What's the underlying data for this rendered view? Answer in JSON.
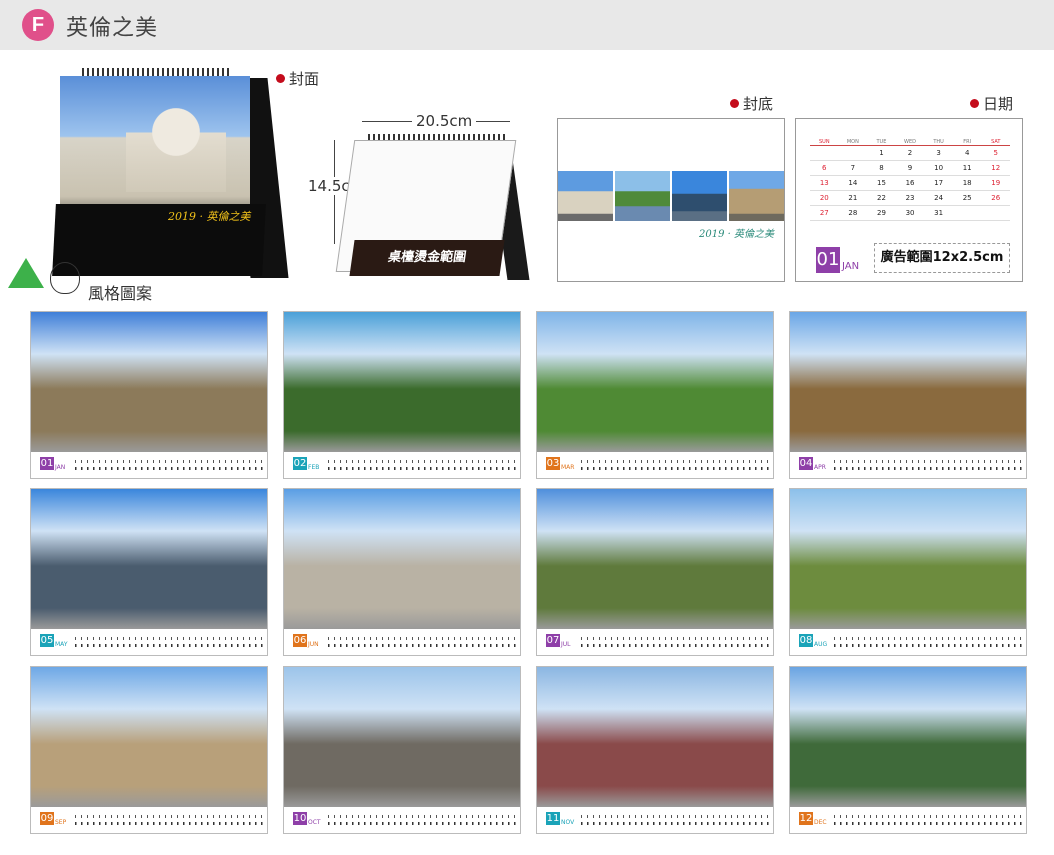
{
  "header": {
    "badge": "F",
    "title": "英倫之美"
  },
  "labels": {
    "cover": "封面",
    "back": "封底",
    "dates": "日期",
    "style": "風格圖案"
  },
  "cover": {
    "brand": "2019 · 英倫之美"
  },
  "blank": {
    "width": "20.5cm",
    "height": "14.5cm",
    "base_text": "桌檯燙金範圍"
  },
  "backcover": {
    "brand": "2019 · 英倫之美"
  },
  "datecard": {
    "weekdays": [
      "SUN",
      "MON",
      "TUE",
      "WED",
      "THU",
      "FRI",
      "SAT"
    ],
    "rows": [
      [
        "",
        "",
        "1",
        "2",
        "3",
        "4",
        "5"
      ],
      [
        "6",
        "7",
        "8",
        "9",
        "10",
        "11",
        "12"
      ],
      [
        "13",
        "14",
        "15",
        "16",
        "17",
        "18",
        "19"
      ],
      [
        "20",
        "21",
        "22",
        "23",
        "24",
        "25",
        "26"
      ],
      [
        "27",
        "28",
        "29",
        "30",
        "31",
        "",
        ""
      ]
    ],
    "month_num": "01",
    "month_abbr": "JAN",
    "ad_text": "廣告範圍12x2.5cm"
  },
  "months": [
    {
      "num": "01",
      "abbr": "JAN",
      "color": "#8e3fa8",
      "sky": "#3f7fd8",
      "ground": "#8c7a5a"
    },
    {
      "num": "02",
      "abbr": "FEB",
      "color": "#1aa3b8",
      "sky": "#4aa0d8",
      "ground": "#3b6b2c"
    },
    {
      "num": "03",
      "abbr": "MAR",
      "color": "#e0741c",
      "sky": "#7fb4e8",
      "ground": "#4f8a34"
    },
    {
      "num": "04",
      "abbr": "APR",
      "color": "#8e3fa8",
      "sky": "#6aa6e6",
      "ground": "#8a6a3e"
    },
    {
      "num": "05",
      "abbr": "MAY",
      "color": "#1aa3b8",
      "sky": "#3a86dc",
      "ground": "#4a5c6e"
    },
    {
      "num": "06",
      "abbr": "JUN",
      "color": "#e0741c",
      "sky": "#5a9ee4",
      "ground": "#b9b2a4"
    },
    {
      "num": "07",
      "abbr": "JUL",
      "color": "#8e3fa8",
      "sky": "#4f8fdc",
      "ground": "#5f7a3c"
    },
    {
      "num": "08",
      "abbr": "AUG",
      "color": "#1aa3b8",
      "sky": "#8cc0ea",
      "ground": "#6d8c3e"
    },
    {
      "num": "09",
      "abbr": "SEP",
      "color": "#e0741c",
      "sky": "#6ea8e6",
      "ground": "#b8a07a"
    },
    {
      "num": "10",
      "abbr": "OCT",
      "color": "#8e3fa8",
      "sky": "#9cc4ea",
      "ground": "#6f6a62"
    },
    {
      "num": "11",
      "abbr": "NOV",
      "color": "#1aa3b8",
      "sky": "#8bb6e2",
      "ground": "#8a4a4a"
    },
    {
      "num": "12",
      "abbr": "DEC",
      "color": "#e0741c",
      "sky": "#6aa4e2",
      "ground": "#3f6a3a"
    }
  ]
}
